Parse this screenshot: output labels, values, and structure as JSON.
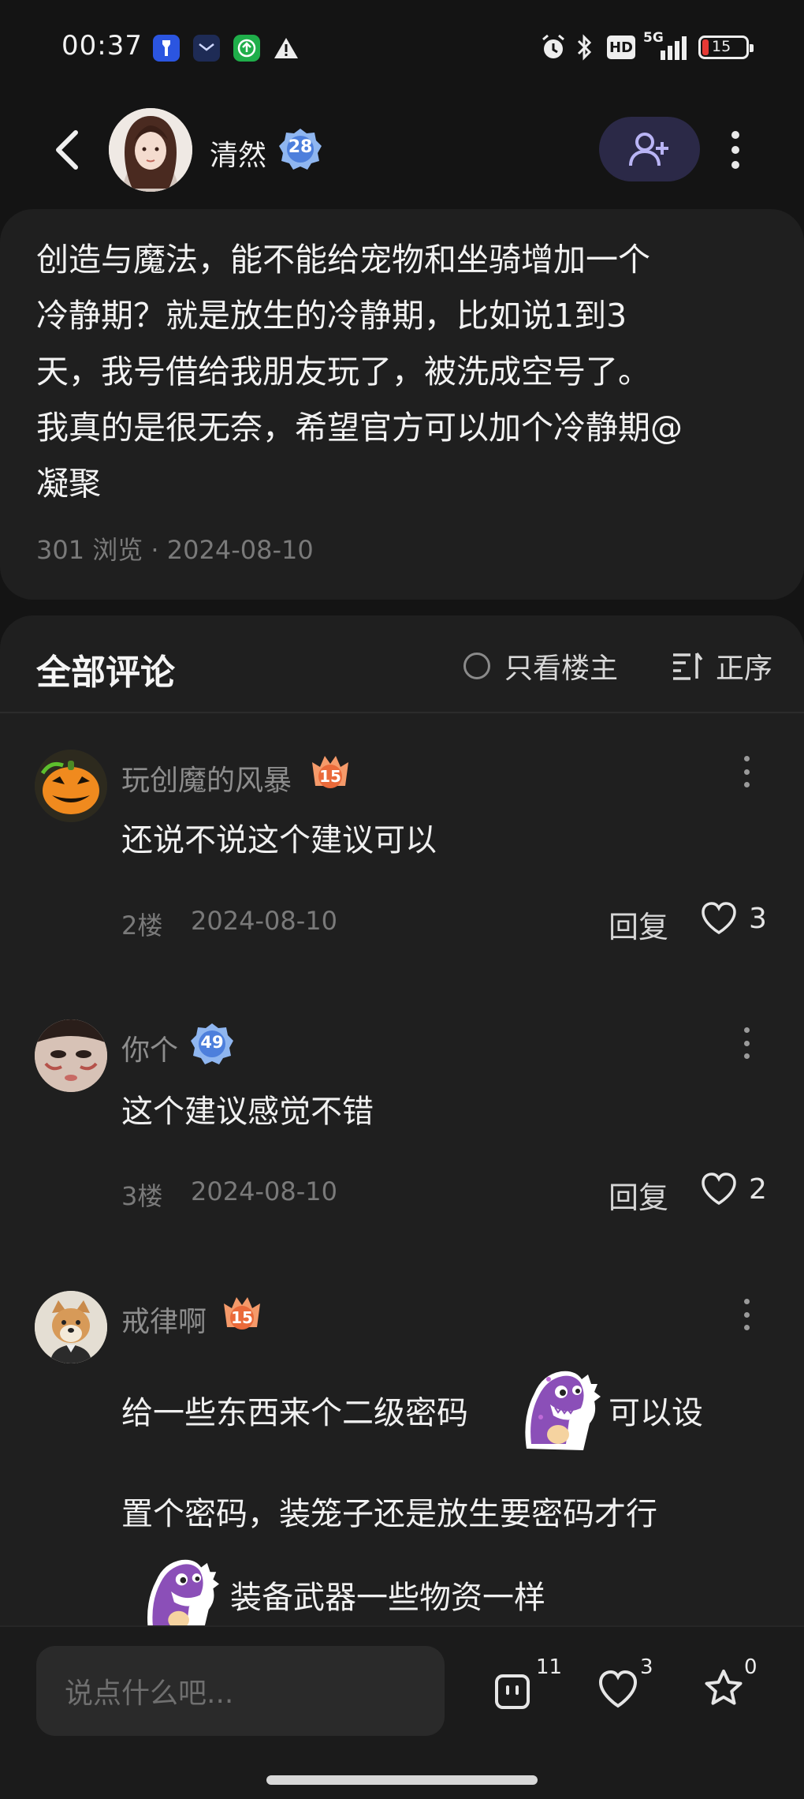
{
  "status_bar": {
    "time": "00:37",
    "icons": [
      "flashlight-app-icon",
      "mail-app-icon",
      "download-app-icon",
      "warning-icon",
      "alarm-icon",
      "bluetooth-icon",
      "hd-icon",
      "5g-signal-icon",
      "battery-icon"
    ],
    "hd_label": "HD",
    "network_label": "5G",
    "battery": "15"
  },
  "header": {
    "username": "清然",
    "level": "28",
    "follow_icon": "add-user-icon"
  },
  "post": {
    "lines": [
      "创造与魔法，能不能给宠物和坐骑增加一个",
      "冷静期？就是放生的冷静期，比如说1到3",
      "天，我号借给我朋友玩了，被洗成空号了。",
      "我真的是很无奈，希望官方可以加个冷静期@",
      "凝聚"
    ],
    "meta": "301 浏览 · 2024-08-10"
  },
  "comments_section": {
    "title": "全部评论",
    "only_op_label": "只看楼主",
    "sort_label": "正序",
    "reply_label": "回复",
    "comments": [
      {
        "user": "玩创魔的风暴",
        "level": "15",
        "text": "还说不说这个建议可以",
        "floor": "2楼",
        "date": "2024-08-10",
        "likes": "3"
      },
      {
        "user": "你个",
        "level": "49",
        "text": "这个建议感觉不错",
        "floor": "3楼",
        "date": "2024-08-10",
        "likes": "2"
      },
      {
        "user": "戒律啊",
        "level": "15",
        "text_parts": [
          "给一些东西来个二级密码",
          "可以设",
          "置个密码，装笼子还是放生要密码才行",
          "装备武器一些物资一样"
        ]
      }
    ]
  },
  "bottom_bar": {
    "input_placeholder": "说点什么吧...",
    "comment_count": "11",
    "like_count": "3",
    "favorite_count": "0"
  },
  "colors": {
    "background": "#141414",
    "card": "#1f1f1f",
    "follow_button": "#2b2947",
    "badge_blue": "#5b8fe8",
    "badge_orange": "#ee7a4a"
  }
}
